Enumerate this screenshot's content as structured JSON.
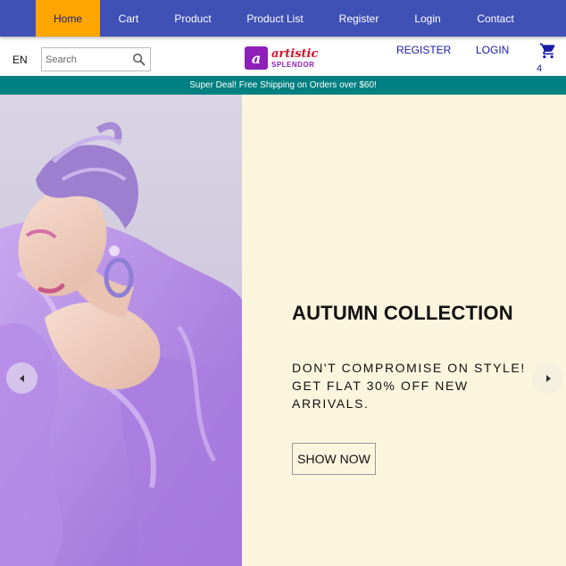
{
  "nav": {
    "items": [
      {
        "label": "Home",
        "active": true
      },
      {
        "label": "Cart",
        "active": false
      },
      {
        "label": "Product",
        "active": false
      },
      {
        "label": "Product List",
        "active": false
      },
      {
        "label": "Register",
        "active": false
      },
      {
        "label": "Login",
        "active": false
      },
      {
        "label": "Contact",
        "active": false
      }
    ]
  },
  "header": {
    "language": "EN",
    "search_placeholder": "Search",
    "search_icon": "search-icon",
    "logo": {
      "line1": "artistic",
      "line2": "SPLENDOR",
      "mark": "a"
    },
    "register_label": "REGISTER",
    "login_label": "LOGIN",
    "cart_icon": "shopping-cart-icon",
    "cart_count": "4"
  },
  "announcement": "Super Deal! Free Shipping on Orders over $60!",
  "hero": {
    "title": "AUTUMN COLLECTION",
    "description": "DON'T COMPROMISE ON STYLE! GET FLAT 30% OFF NEW ARRIVALS.",
    "button_label": "SHOW NOW",
    "prev_icon": "arrow-left-icon",
    "next_icon": "arrow-right-icon"
  },
  "colors": {
    "nav_bg": "#3f51b5",
    "nav_active": "#ffa500",
    "announce_bg": "#008080",
    "hero_bg": "#fcf5de",
    "link": "#1a1aa6"
  }
}
